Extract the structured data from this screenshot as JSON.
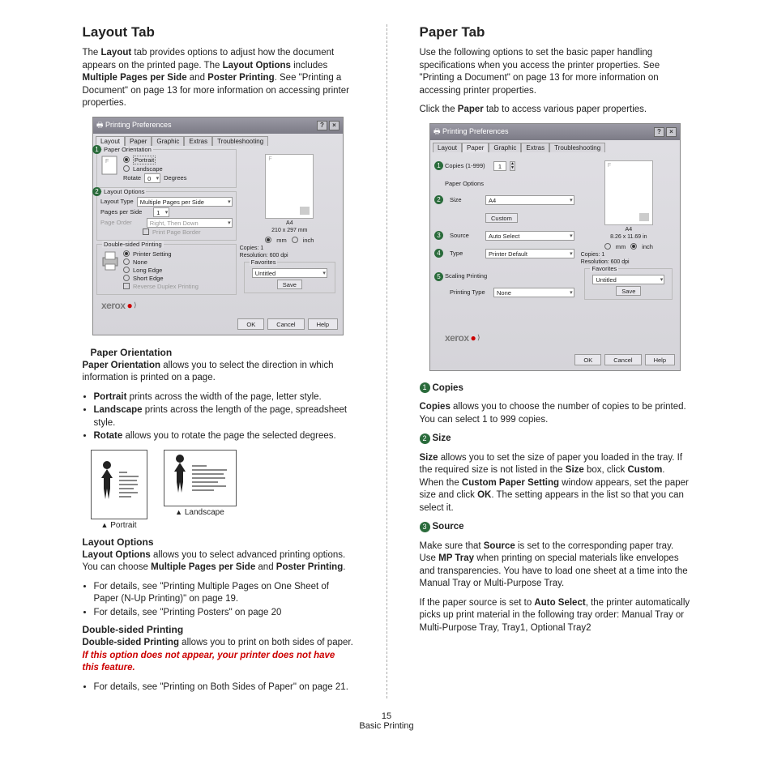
{
  "left": {
    "h2": "Layout Tab",
    "intro1": "The ",
    "intro1b": "Layout",
    "intro2": " tab provides options to adjust how the document appears on the printed page. The ",
    "intro2b": "Layout Options",
    "intro3": " includes ",
    "intro3b": "Multiple Pages per Side",
    "intro4": " and ",
    "intro4b": "Poster Printing",
    "intro5": ". See \"Printing a Document\" on page 13 for more information on accessing printer properties.",
    "dlg": {
      "title": "Printing Preferences",
      "tabs": [
        "Layout",
        "Paper",
        "Graphic",
        "Extras",
        "Troubleshooting"
      ],
      "activeTab": "Layout",
      "grp1": "Paper Orientation",
      "portrait": "Portrait",
      "landscape": "Landscape",
      "rotate": "Rotate",
      "rotateVal": "0",
      "degrees": "Degrees",
      "grp2": "Layout Options",
      "layoutType": "Layout Type",
      "layoutTypeVal": "Multiple Pages per Side",
      "pps": "Pages per Side",
      "ppsVal": "1",
      "pageOrder": "Page Order",
      "pageOrderVal": "Right, Then Down",
      "printBorder": "Print Page Border",
      "grp3": "Double-sided Printing",
      "ds1": "Printer Setting",
      "ds2": "None",
      "ds3": "Long Edge",
      "ds4": "Short Edge",
      "ds5": "Reverse Duplex Printing",
      "previewLabel": "A4",
      "previewDim": "210 x 297 mm",
      "unitmm": "mm",
      "unitin": "inch",
      "copies": "Copies: 1",
      "res": "Resolution: 600 dpi",
      "favs": "Favorites",
      "favVal": "Untitled",
      "save": "Save",
      "brand": "xerox",
      "ok": "OK",
      "cancel": "Cancel",
      "help": "Help"
    },
    "sec1h": "Paper Orientation",
    "sec1_1b": "Paper Orientation",
    "sec1_1": " allows you to select the direction in which information is printed on a page.",
    "li1b": "Portrait",
    "li1": " prints across the width of the page, letter style.",
    "li2b": "Landscape",
    "li2": " prints across the length of the page, spreadsheet style.",
    "li3b": "Rotate",
    "li3": " allows you to rotate the page the selected degrees.",
    "capP": "Portrait",
    "capL": "Landscape",
    "sec2h": "Layout Options",
    "sec2_1b": "Layout Options",
    "sec2_1": " allows you to select advanced printing options. You can choose ",
    "sec2_1b2": "Multiple Pages per Side",
    "sec2_1m": " and ",
    "sec2_1b3": "Poster Printing",
    "sec2_1e": ".",
    "li4": "For details, see \"Printing Multiple Pages on One Sheet of Paper (N-Up Printing)\" on page 19.",
    "li5": "For details, see \"Printing Posters\" on page 20",
    "sec3h": "Double-sided Printing",
    "sec3_1b": "Double-sided Printing",
    "sec3_1": " allows you to print on both sides of paper. ",
    "sec3_1it": "If this option does not appear, your printer does not have this feature.",
    "li6": "For details, see \"Printing on Both Sides of Paper\" on page 21."
  },
  "right": {
    "h2": "Paper Tab",
    "intro": "Use the following options to set the basic paper handling specifications when you access the printer properties. See \"Printing a Document\" on page 13 for more information on accessing printer properties.",
    "click1": "Click the ",
    "click1b": "Paper",
    "click2": " tab to access various paper properties.",
    "dlg": {
      "title": "Printing Preferences",
      "tabs": [
        "Layout",
        "Paper",
        "Graphic",
        "Extras",
        "Troubleshooting"
      ],
      "activeTab": "Paper",
      "copies": "Copies (1-999)",
      "copiesVal": "1",
      "paperOptions": "Paper Options",
      "size": "Size",
      "sizeVal": "A4",
      "custom": "Custom",
      "source": "Source",
      "sourceVal": "Auto Select",
      "type": "Type",
      "typeVal": "Printer Default",
      "scaling": "Scaling Printing",
      "ptype": "Printing Type",
      "ptypeVal": "None",
      "brand": "xerox",
      "previewLabel": "A4",
      "previewDim": "8.26 x 11.69 in",
      "unitmm": "mm",
      "unitin": "inch",
      "copies2": "Copies: 1",
      "res": "Resolution: 600 dpi",
      "favs": "Favorites",
      "favVal": "Untitled",
      "save": "Save",
      "ok": "OK",
      "cancel": "Cancel",
      "help": "Help"
    },
    "s1h": "Copies",
    "s1b": "Copies",
    "s1": " allows you to choose the number of copies to be printed. You can select 1 to 999 copies.",
    "s2h": "Size",
    "s2b": "Size",
    "s2a": " allows you to set the size of paper you loaded in the tray. If the required size is not listed in the ",
    "s2b2": "Size",
    "s2c": " box, click ",
    "s2b3": "Custom",
    "s2d": ". When the ",
    "s2b4": "Custom Paper Setting",
    "s2e": " window appears, set the paper size and click ",
    "s2b5": "OK",
    "s2f": ". The setting appears in the list so that you can select it.",
    "s3h": "Source",
    "s3a": "Make sure that ",
    "s3b": "Source",
    "s3c": " is set to the corresponding paper tray. Use ",
    "s3b2": "MP Tray",
    "s3d": " when printing on special materials like envelopes and transparencies. You have to load one sheet at a time into the Manual Tray or Multi-Purpose Tray.",
    "s3e": "If the paper source is set to ",
    "s3b3": "Auto Select",
    "s3f": ", the printer automatically picks up print material in the following tray order: Manual Tray or Multi-Purpose Tray, Tray1, Optional Tray2"
  },
  "pageNum": "15",
  "pageLabel": "Basic Printing"
}
